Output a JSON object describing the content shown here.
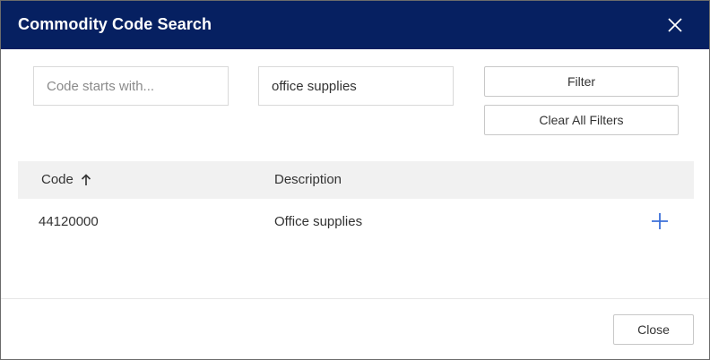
{
  "dialog": {
    "title": "Commodity Code Search"
  },
  "filters": {
    "code_placeholder": "Code starts with...",
    "code_value": "",
    "description_placeholder": "",
    "description_value": "office supplies",
    "filter_label": "Filter",
    "clear_label": "Clear All Filters"
  },
  "table": {
    "columns": [
      "Code",
      "Description"
    ],
    "rows": [
      {
        "code": "44120000",
        "description": "Office supplies"
      }
    ]
  },
  "footer": {
    "close_label": "Close"
  },
  "colors": {
    "header_bg": "#062061",
    "accent": "#3b6fd8"
  },
  "icons": {
    "close": "close-icon",
    "sort": "arrow-up-icon",
    "add": "plus-icon"
  }
}
